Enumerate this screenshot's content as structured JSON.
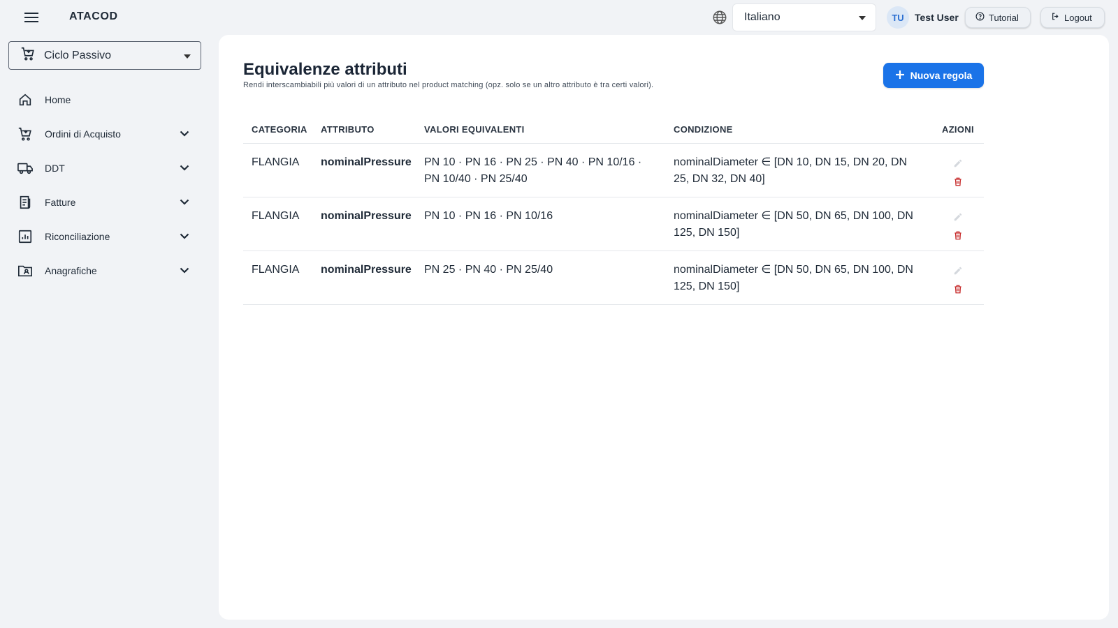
{
  "app": {
    "title": "ATACOD"
  },
  "header": {
    "language": "Italiano",
    "user_initials": "TU",
    "user_name": "Test User",
    "tutorial_label": "Tutorial",
    "logout_label": "Logout"
  },
  "sidebar": {
    "module": "Ciclo Passivo",
    "items": [
      {
        "label": "Home",
        "icon": "home-icon",
        "expandable": false
      },
      {
        "label": "Ordini di Acquisto",
        "icon": "cart-icon",
        "expandable": true
      },
      {
        "label": "DDT",
        "icon": "truck-icon",
        "expandable": true
      },
      {
        "label": "Fatture",
        "icon": "receipt-icon",
        "expandable": true
      },
      {
        "label": "Riconciliazione",
        "icon": "chart-icon",
        "expandable": true
      },
      {
        "label": "Anagrafiche",
        "icon": "contact-folder-icon",
        "expandable": true
      }
    ]
  },
  "main": {
    "title": "Equivalenze attributi",
    "subtitle": "Rendi interscambiabili più valori di un attributo nel product matching (opz. solo se un altro attributo è tra certi valori).",
    "new_rule_label": "Nuova regola",
    "columns": {
      "category": "CATEGORIA",
      "attribute": "ATTRIBUTO",
      "values": "VALORI EQUIVALENTI",
      "condition": "CONDIZIONE",
      "actions": "AZIONI"
    },
    "rows": [
      {
        "category": "FLANGIA",
        "attribute": "nominalPressure",
        "values": "PN 10 · PN 16 · PN 25 · PN 40 · PN 10/16 · PN 10/40 · PN 25/40",
        "condition": "nominalDiameter ∈ [DN 10, DN 15, DN 20, DN 25, DN 32, DN 40]"
      },
      {
        "category": "FLANGIA",
        "attribute": "nominalPressure",
        "values": "PN 10 · PN 16 · PN 10/16",
        "condition": "nominalDiameter ∈ [DN 50, DN 65, DN 100, DN 125, DN 150]"
      },
      {
        "category": "FLANGIA",
        "attribute": "nominalPressure",
        "values": "PN 25 · PN 40 · PN 25/40",
        "condition": "nominalDiameter ∈ [DN 50, DN 65, DN 100, DN 125, DN 150]"
      }
    ]
  },
  "colors": {
    "primary": "#1a73e8",
    "delete": "#c62828",
    "background": "#f1f3f6",
    "card": "#ffffff"
  }
}
